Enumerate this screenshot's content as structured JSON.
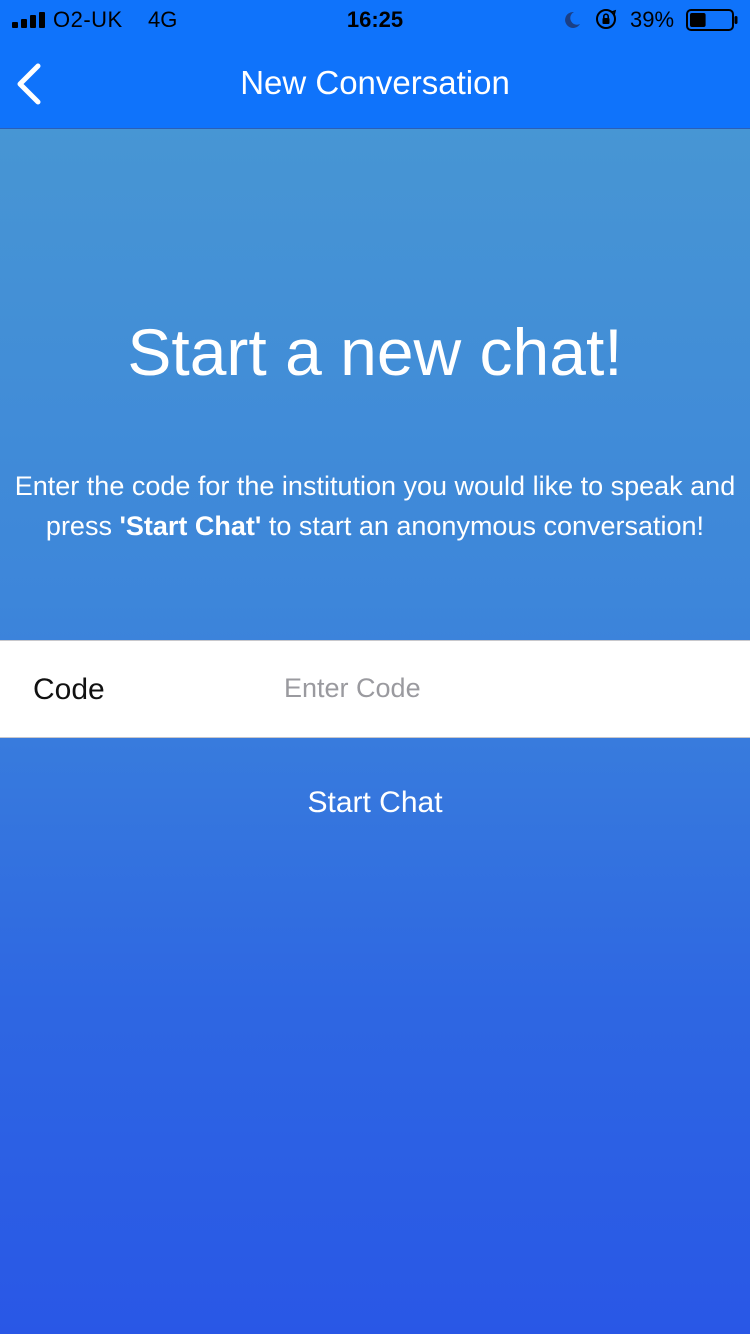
{
  "status_bar": {
    "carrier": "O2-UK",
    "network": "4G",
    "time": "16:25",
    "battery_percent": "39%",
    "battery_level": 0.39,
    "icons": [
      "signal-icon",
      "moon-icon",
      "rotation-lock-icon",
      "battery-icon"
    ]
  },
  "nav": {
    "title": "New Conversation",
    "back_icon": "chevron-left-icon"
  },
  "main": {
    "headline": "Start a new chat!",
    "description_part1": "Enter the code for the institution you would like to speak and press ",
    "description_strong": "'Start Chat'",
    "description_part2": " to start an anonymous conversation!"
  },
  "form": {
    "code_label": "Code",
    "code_placeholder": "Enter Code",
    "code_value": ""
  },
  "actions": {
    "start_chat_label": "Start Chat"
  },
  "colors": {
    "nav_bar": "#0f73fb",
    "gradient_top": "#4a9ad2",
    "gradient_bottom": "#2957e6",
    "text_on_accent": "#ffffff"
  }
}
